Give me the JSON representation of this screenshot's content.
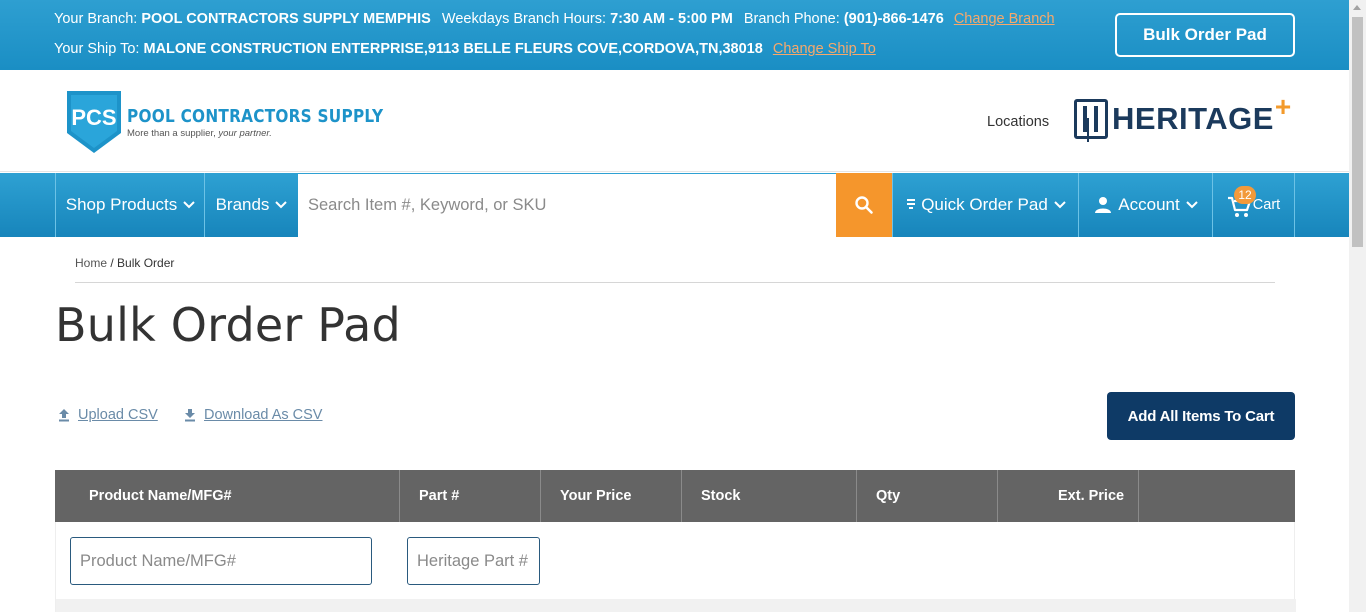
{
  "topbar": {
    "branch_label": "Your Branch:",
    "branch_name": "POOL CONTRACTORS SUPPLY MEMPHIS",
    "hours_label": "Weekdays Branch Hours:",
    "hours_value": "7:30 AM - 5:00 PM",
    "phone_label": "Branch Phone:",
    "phone_value": "(901)-866-1476",
    "change_branch": "Change Branch",
    "shipto_label": "Your Ship To:",
    "shipto_value": "MALONE CONSTRUCTION ENTERPRISE,9113 BELLE FLEURS COVE,CORDOVA,TN,38018",
    "change_shipto": "Change Ship To",
    "bulk_order_button": "Bulk Order Pad"
  },
  "header": {
    "logo_abbr": "PCS",
    "logo_name": "POOL CONTRACTORS SUPPLY",
    "logo_tagline_plain": "More than a supplier, ",
    "logo_tagline_italic": "your partner.",
    "locations": "Locations",
    "heritage_name": "HERITAGE",
    "heritage_plus": "+"
  },
  "nav": {
    "shop_products": "Shop Products",
    "brands": "Brands",
    "search_placeholder": "Search Item #, Keyword, or SKU",
    "quick_order_pad": "Quick Order Pad",
    "account": "Account",
    "cart": "Cart",
    "cart_count": "12"
  },
  "breadcrumb": {
    "home": "Home",
    "separator": " / ",
    "current": "Bulk Order"
  },
  "page": {
    "title": "Bulk Order Pad",
    "upload_csv": "Upload CSV",
    "download_csv": "Download As CSV",
    "add_all_button": "Add All Items To Cart"
  },
  "table": {
    "headers": {
      "product": "Product Name/MFG#",
      "part": "Part #",
      "price": "Your Price",
      "stock": "Stock",
      "qty": "Qty",
      "ext_price": "Ext. Price"
    },
    "product_placeholder": "Product Name/MFG#",
    "part_placeholder": "Heritage Part #"
  },
  "colors": {
    "topbar_blue": "#1d93c9",
    "search_orange": "#f5962c",
    "add_all_navy": "#0e3a66",
    "table_header_gray": "#646464",
    "link_orange": "#f7a86b"
  },
  "icons": {
    "search": "search-icon",
    "chevron": "chevron-down-icon",
    "user": "user-icon",
    "cart": "cart-icon",
    "quick_order": "list-icon",
    "upload": "upload-icon",
    "download": "download-icon"
  }
}
